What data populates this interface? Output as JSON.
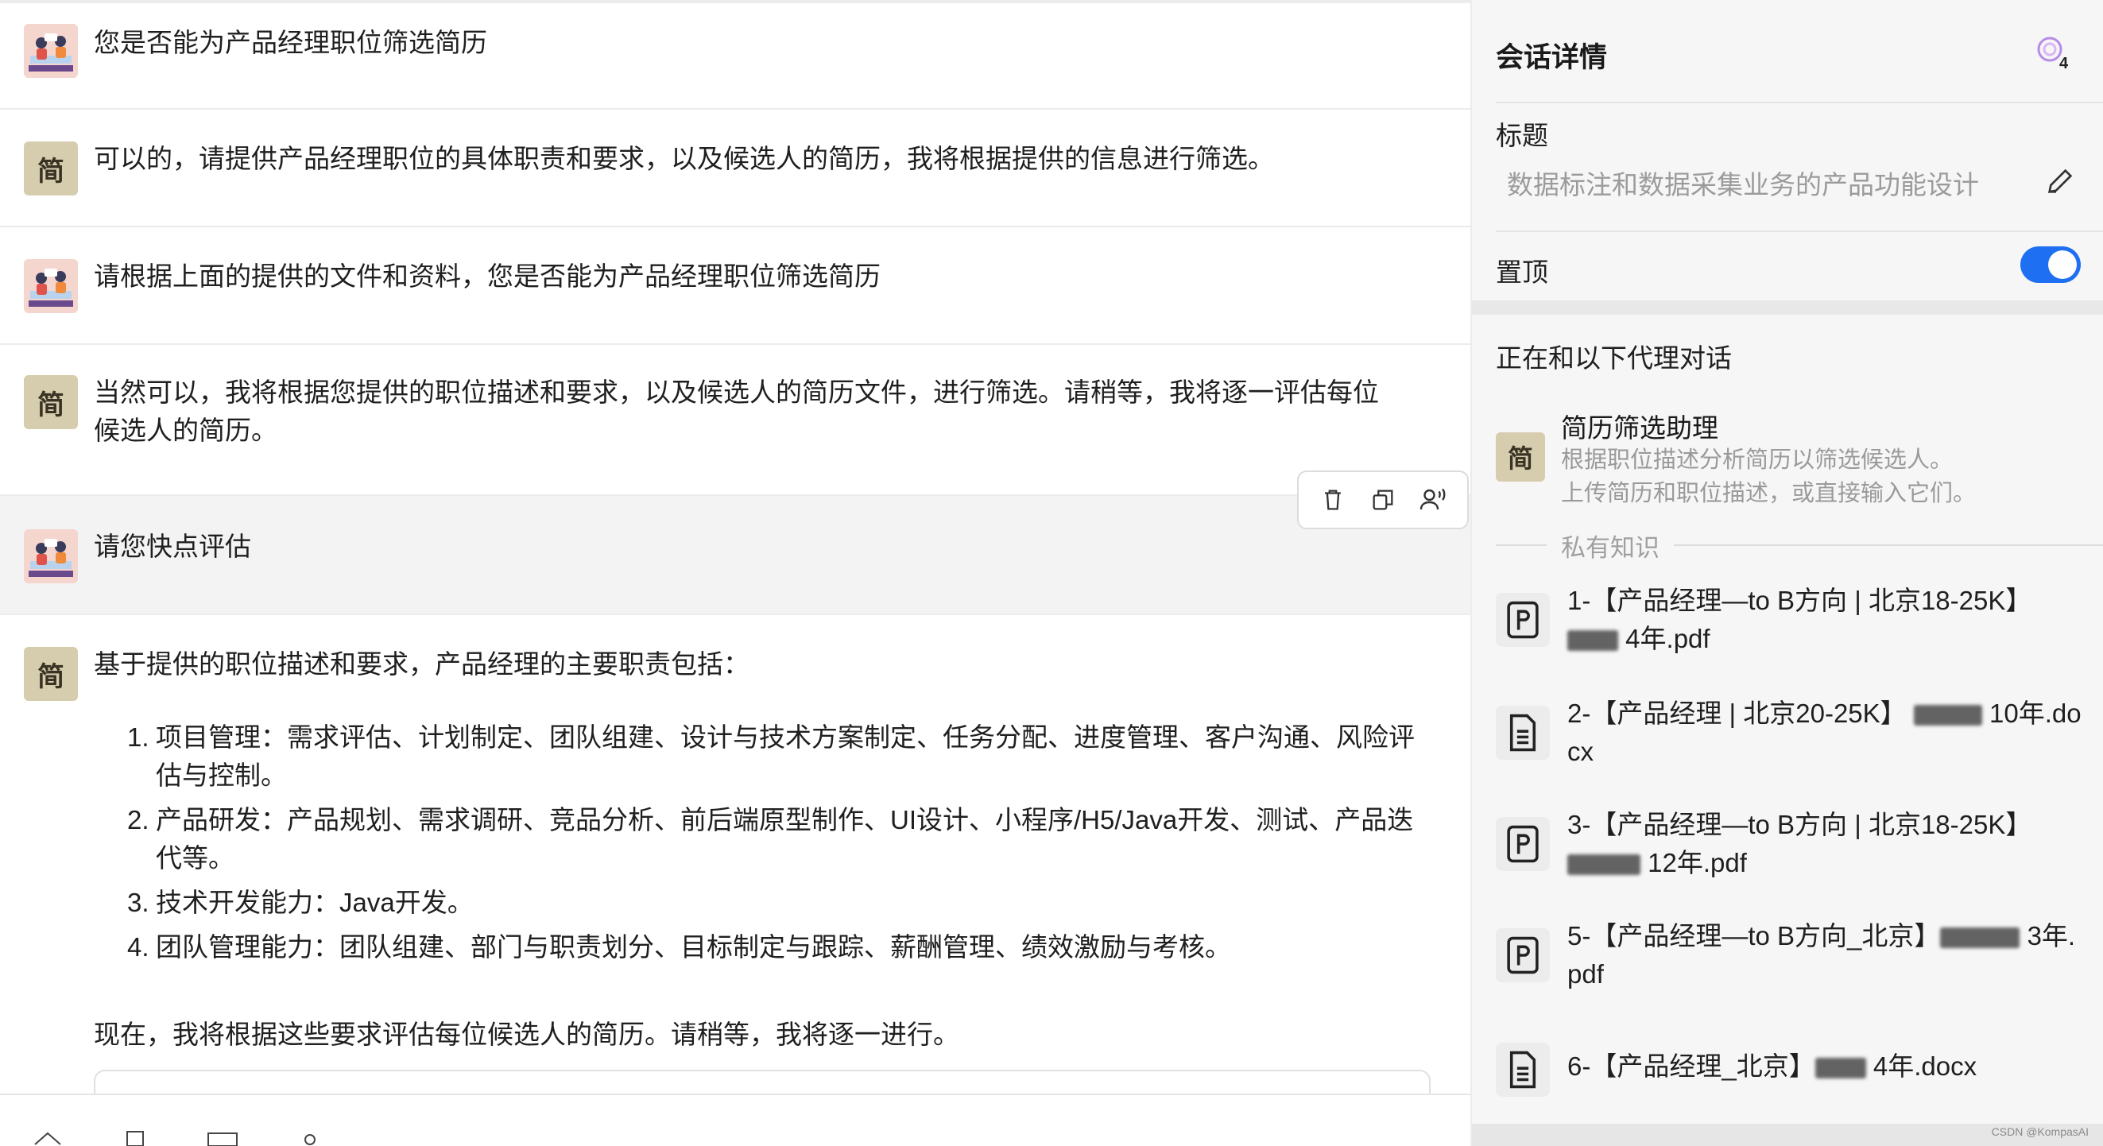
{
  "chat": {
    "messages": [
      {
        "role": "user",
        "text": "您是否能为产品经理职位筛选简历"
      },
      {
        "role": "bot",
        "avatar": "简",
        "text": "可以的，请提供产品经理职位的具体职责和要求，以及候选人的简历，我将根据提供的信息进行筛选。"
      },
      {
        "role": "user",
        "text": "请根据上面的提供的文件和资料，您是否能为产品经理职位筛选简历"
      },
      {
        "role": "bot",
        "avatar": "简",
        "line1": "当然可以，我将根据您提供的职位描述和要求，以及候选人的简历文件，进行筛选。请稍等，我将逐一评估每位",
        "line2": "候选人的简历。"
      },
      {
        "role": "user",
        "text": "请您快点评估"
      },
      {
        "role": "bot",
        "avatar": "简",
        "intro": "基于提供的职位描述和要求，产品经理的主要职责包括：",
        "items": [
          {
            "num": "1.",
            "text": "项目管理：需求评估、计划制定、团队组建、设计与技术方案制定、任务分配、进度管理、客户沟通、风险评估与控制。"
          },
          {
            "num": "2.",
            "text": "产品研发：产品规划、需求调研、竞品分析、前后端原型制作、UI设计、小程序/H5/Java开发、测试、产品迭代等。"
          },
          {
            "num": "3.",
            "text": "技术开发能力：Java开发。"
          },
          {
            "num": "4.",
            "text": "团队管理能力：团队组建、部门与职责划分、目标制定与跟踪、薪酬管理、绩效激励与考核。"
          }
        ],
        "outro": "现在，我将根据这些要求评估每位候选人的简历。请稍等，我将逐一进行。"
      }
    ],
    "toolbar": {
      "delete_icon": "trash-icon",
      "copy_icon": "copy-icon",
      "speak_icon": "voice-icon"
    }
  },
  "sidebar": {
    "title": "会话详情",
    "badge_count": "4",
    "title_label": "标题",
    "title_value": "数据标注和数据采集业务的产品功能设计",
    "pin_label": "置顶",
    "pin_on": true,
    "agent_section": "正在和以下代理对话",
    "agent": {
      "avatar": "简",
      "name": "简历筛选助理",
      "desc1": "根据职位描述分析简历以筛选候选人。",
      "desc2": "上传简历和职位描述，或直接输入它们。"
    },
    "knowledge_label": "私有知识",
    "files": [
      {
        "type": "pdf",
        "a": "1-【产品经理—to B方向 | 北京18-25K】",
        "b": " 4年.pdf"
      },
      {
        "type": "doc",
        "a": "2-【产品经理 | 北京20-25K】 ",
        "b": " 10年.docx"
      },
      {
        "type": "pdf",
        "a": "3-【产品经理—to B方向 | 北京18-25K】",
        "b": " 12年.pdf"
      },
      {
        "type": "pdf",
        "a": "5-【产品经理—to B方向_北京】",
        "b": " 3年.pdf"
      },
      {
        "type": "doc",
        "a": "6-【产品经理_北京】",
        "b": " 4年.docx"
      }
    ]
  },
  "accent": "#1e6ff1",
  "watermark": "CSDN @KompasAI"
}
